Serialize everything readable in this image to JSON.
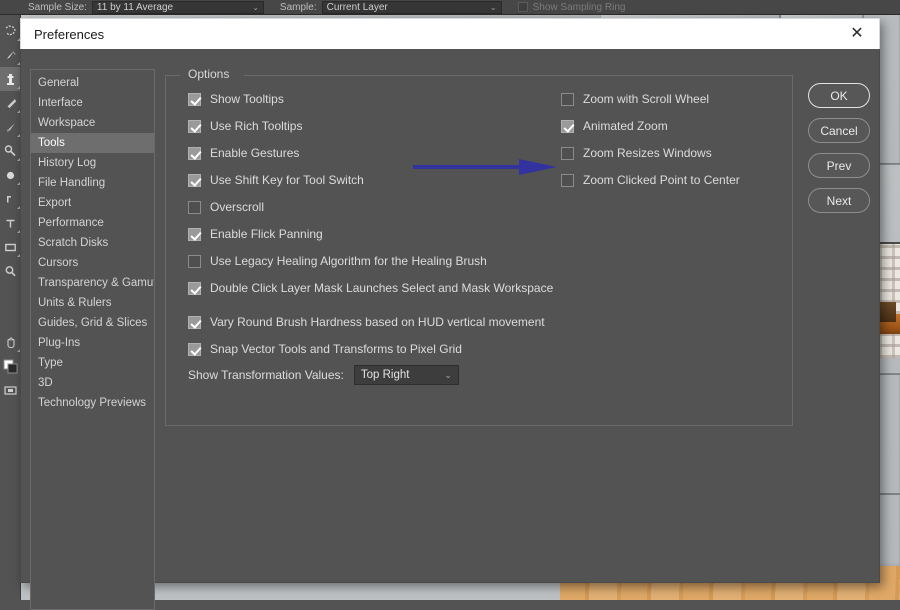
{
  "app": {
    "options_bar": {
      "sample_size_label": "Sample Size:",
      "sample_size_value": "11 by 11 Average",
      "sample_label": "Sample:",
      "sample_value": "Current Layer",
      "show_sampling_ring_label": "Show Sampling Ring",
      "chevron": "⌄"
    },
    "toolbar": {
      "tools": [
        {
          "name": "lasso-tool"
        },
        {
          "name": "brush-tool"
        },
        {
          "name": "clone-stamp-tool"
        },
        {
          "name": "eraser-tool"
        },
        {
          "name": "blur-tool"
        },
        {
          "name": "dodge-tool"
        },
        {
          "name": "pen-tool"
        },
        {
          "name": "shape-tool"
        },
        {
          "name": "zoom-tool"
        },
        {
          "name": "hand-tool"
        },
        {
          "name": "foreground-background-color"
        },
        {
          "name": "quick-mask-toggle"
        }
      ]
    }
  },
  "dialog": {
    "title": "Preferences",
    "close_icon": "✕",
    "sidebar": {
      "items": [
        {
          "label": "General",
          "selected": false
        },
        {
          "label": "Interface",
          "selected": false
        },
        {
          "label": "Workspace",
          "selected": false
        },
        {
          "label": "Tools",
          "selected": true
        },
        {
          "label": "History Log",
          "selected": false
        },
        {
          "label": "File Handling",
          "selected": false
        },
        {
          "label": "Export",
          "selected": false
        },
        {
          "label": "Performance",
          "selected": false
        },
        {
          "label": "Scratch Disks",
          "selected": false
        },
        {
          "label": "Cursors",
          "selected": false
        },
        {
          "label": "Transparency & Gamut",
          "selected": false
        },
        {
          "label": "Units & Rulers",
          "selected": false
        },
        {
          "label": "Guides, Grid & Slices",
          "selected": false
        },
        {
          "label": "Plug-Ins",
          "selected": false
        },
        {
          "label": "Type",
          "selected": false
        },
        {
          "label": "3D",
          "selected": false
        },
        {
          "label": "Technology Previews",
          "selected": false
        }
      ]
    },
    "options": {
      "legend": "Options",
      "left_column": [
        {
          "label": "Show Tooltips",
          "checked": true,
          "gap": false
        },
        {
          "label": "Use Rich Tooltips",
          "checked": true,
          "gap": false
        },
        {
          "label": "Enable Gestures",
          "checked": true,
          "gap": false
        },
        {
          "label": "Use Shift Key for Tool Switch",
          "checked": true,
          "gap": false
        },
        {
          "label": "Overscroll",
          "checked": false,
          "gap": false
        },
        {
          "label": "Enable Flick Panning",
          "checked": true,
          "gap": false
        },
        {
          "label": "Use Legacy Healing Algorithm for the Healing Brush",
          "checked": false,
          "gap": false
        },
        {
          "label": "Double Click Layer Mask Launches Select and Mask Workspace",
          "checked": true,
          "gap": false
        },
        {
          "label": "Vary Round Brush Hardness based on HUD vertical movement",
          "checked": true,
          "gap": true
        },
        {
          "label": "Snap Vector Tools and Transforms to Pixel Grid",
          "checked": true,
          "gap": false
        }
      ],
      "right_column": [
        {
          "label": "Zoom with Scroll Wheel",
          "checked": false
        },
        {
          "label": "Animated Zoom",
          "checked": true
        },
        {
          "label": "Zoom Resizes Windows",
          "checked": false
        },
        {
          "label": "Zoom Clicked Point to Center",
          "checked": false
        }
      ],
      "transform_values": {
        "label": "Show Transformation Values:",
        "value": "Top Right",
        "chevron": "⌄"
      }
    },
    "buttons": [
      {
        "label": "OK",
        "primary": true
      },
      {
        "label": "Cancel",
        "primary": false
      },
      {
        "label": "Prev",
        "primary": false
      },
      {
        "label": "Next",
        "primary": false
      }
    ]
  },
  "annotation": {
    "arrow_name": "blue-arrow-pointing-to-animated-zoom",
    "color": "#3333a0"
  }
}
